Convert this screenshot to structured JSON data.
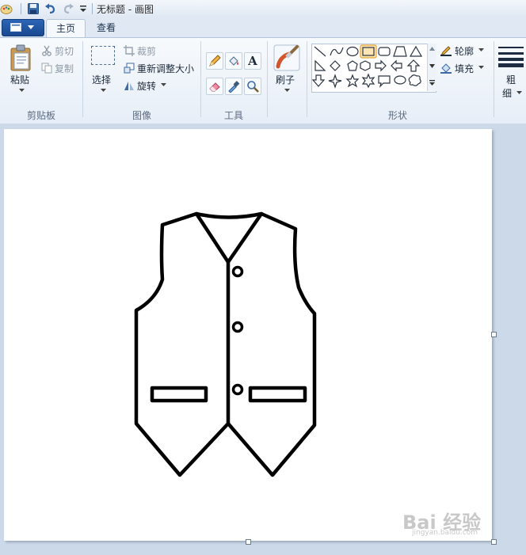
{
  "window": {
    "title": "无标题 - 画图"
  },
  "tabs": [
    {
      "label": "主页",
      "active": true
    },
    {
      "label": "查看",
      "active": false
    }
  ],
  "clipboard": {
    "paste_label": "粘贴",
    "cut_label": "剪切",
    "copy_label": "复制",
    "group_label": "剪贴板"
  },
  "image": {
    "select_label": "选择",
    "crop_label": "裁剪",
    "resize_label": "重新调整大小",
    "rotate_label": "旋转",
    "group_label": "图像"
  },
  "tools": {
    "group_label": "工具",
    "icons": [
      "pencil-icon",
      "fill-icon",
      "text-icon",
      "eraser-icon",
      "color-picker-icon",
      "magnifier-icon"
    ],
    "text_glyph": "A"
  },
  "brushes": {
    "label": "刷子"
  },
  "shapes": {
    "group_label": "形状",
    "outline_label": "轮廓",
    "fill_label": "填充",
    "size_label_1": "粗",
    "size_label_2": "细",
    "selected_shape": "rectangle"
  },
  "colors": {
    "accent": "#2c66b6",
    "selection": "#f6b74a"
  },
  "watermark": {
    "text": "Bai 经验",
    "sub": "jingyan.baidu.com"
  }
}
